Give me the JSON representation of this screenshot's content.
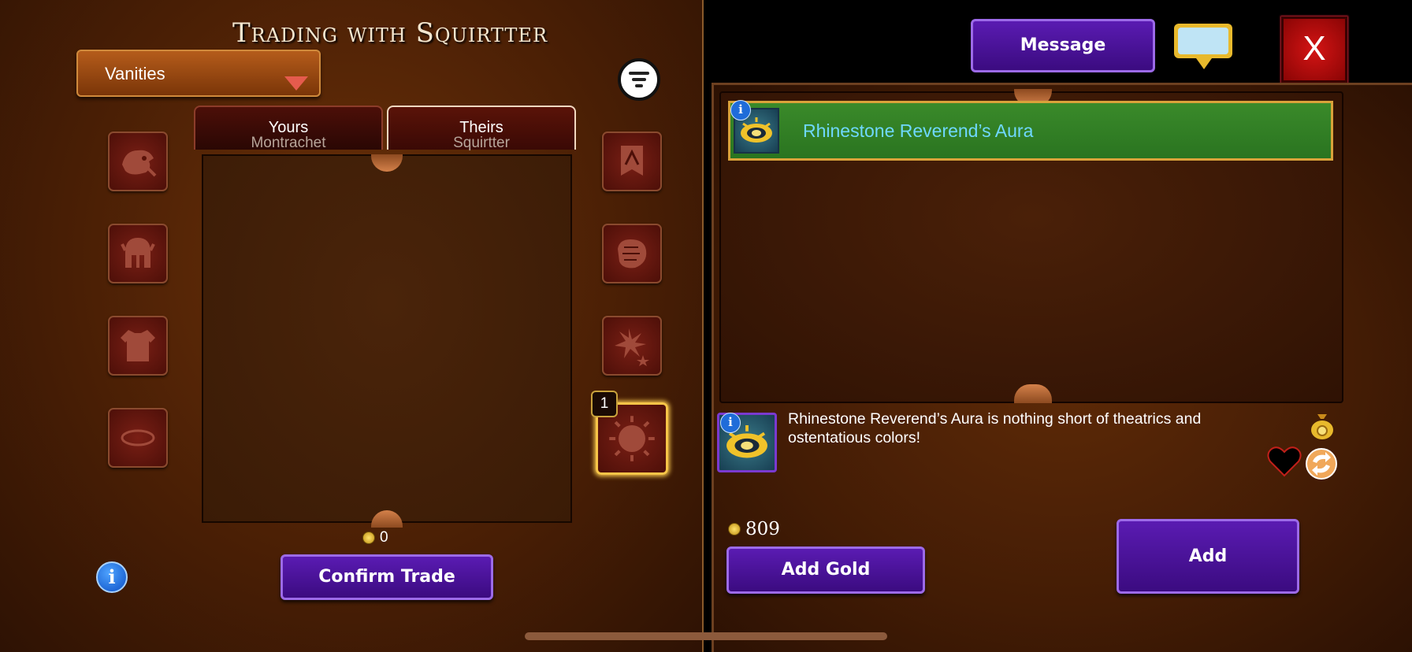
{
  "header": {
    "title": "Trading with Squirtter"
  },
  "filter": {
    "category_selected": "Vanities"
  },
  "tabs": [
    {
      "label": "Yours",
      "sublabel": "Montrachet",
      "active": false
    },
    {
      "label": "Theirs",
      "sublabel": "Squirtter",
      "active": true
    }
  ],
  "left_slots": [
    "pet-icon",
    "helmet-icon",
    "robe-icon",
    "halo-icon"
  ],
  "right_slots": [
    "banner-icon",
    "gauntlet-icon",
    "burst-icon",
    "sun-aura-icon"
  ],
  "selected_slot": {
    "icon": "sun-aura-icon",
    "count": "1"
  },
  "trade": {
    "gold_offered": "0",
    "confirm_label": "Confirm Trade"
  },
  "top_bar": {
    "message_label": "Message",
    "close_label": "X"
  },
  "item_list": [
    {
      "name": "Rhinestone Reverend’s Aura",
      "selected": true,
      "highlight_color": "#2a7420"
    }
  ],
  "details": {
    "description": "Rhinestone Reverend’s Aura is nothing short of theatrics and ostentatious colors!"
  },
  "wallet": {
    "gold": "809",
    "add_gold_label": "Add Gold",
    "add_label": "Add"
  },
  "colors": {
    "accent_purple": "#4a129a",
    "selected_gold": "#f7c548",
    "close_red": "#c41010",
    "item_text": "#6fd8ff"
  }
}
